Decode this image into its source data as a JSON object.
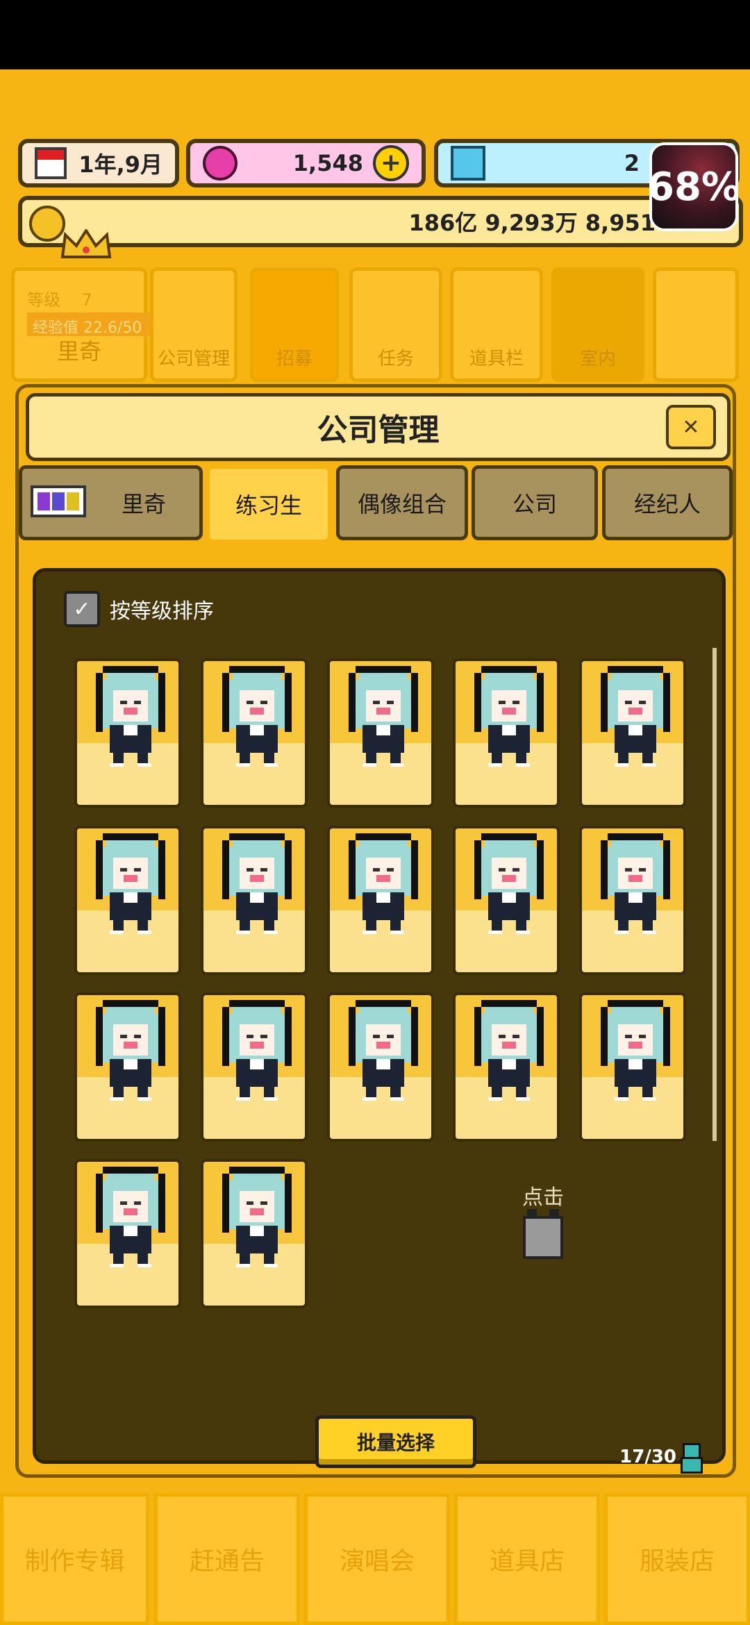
{
  "stats": {
    "date": "1年,9月",
    "gems": "1,548",
    "diamonds": "2",
    "money": "186亿 9,293万 8,951"
  },
  "overlay": {
    "battery": "68%"
  },
  "top_nav": {
    "level_label": "等级",
    "level_value": "7",
    "exp_label": "经验值 22.6/50",
    "manager_name": "里奇",
    "items": [
      {
        "label": "公司管理"
      },
      {
        "label": "招募"
      },
      {
        "label": "任务"
      },
      {
        "label": "道具栏"
      },
      {
        "label": "室内"
      },
      {
        "label": ""
      }
    ]
  },
  "panel": {
    "title": "公司管理",
    "close_icon": "close-icon",
    "tabs": [
      {
        "label": "里奇",
        "active": false
      },
      {
        "label": "练习生",
        "active": true
      },
      {
        "label": "偶像组合",
        "active": false
      },
      {
        "label": "公司",
        "active": false
      },
      {
        "label": "经纪人",
        "active": false
      }
    ],
    "sort_label": "按等级排序",
    "trainee_count": 17,
    "hint_label": "点击",
    "batch_button": "批量选择",
    "capacity": "17/30"
  },
  "bottom_nav": [
    {
      "label": "制作专辑"
    },
    {
      "label": "赶通告"
    },
    {
      "label": "演唱会"
    },
    {
      "label": "道具店"
    },
    {
      "label": "服装店"
    }
  ],
  "colors": {
    "background": "#f7b514",
    "panel_dark": "#47380b",
    "card": "#fbe08e",
    "hair": "#9fd9d6"
  }
}
